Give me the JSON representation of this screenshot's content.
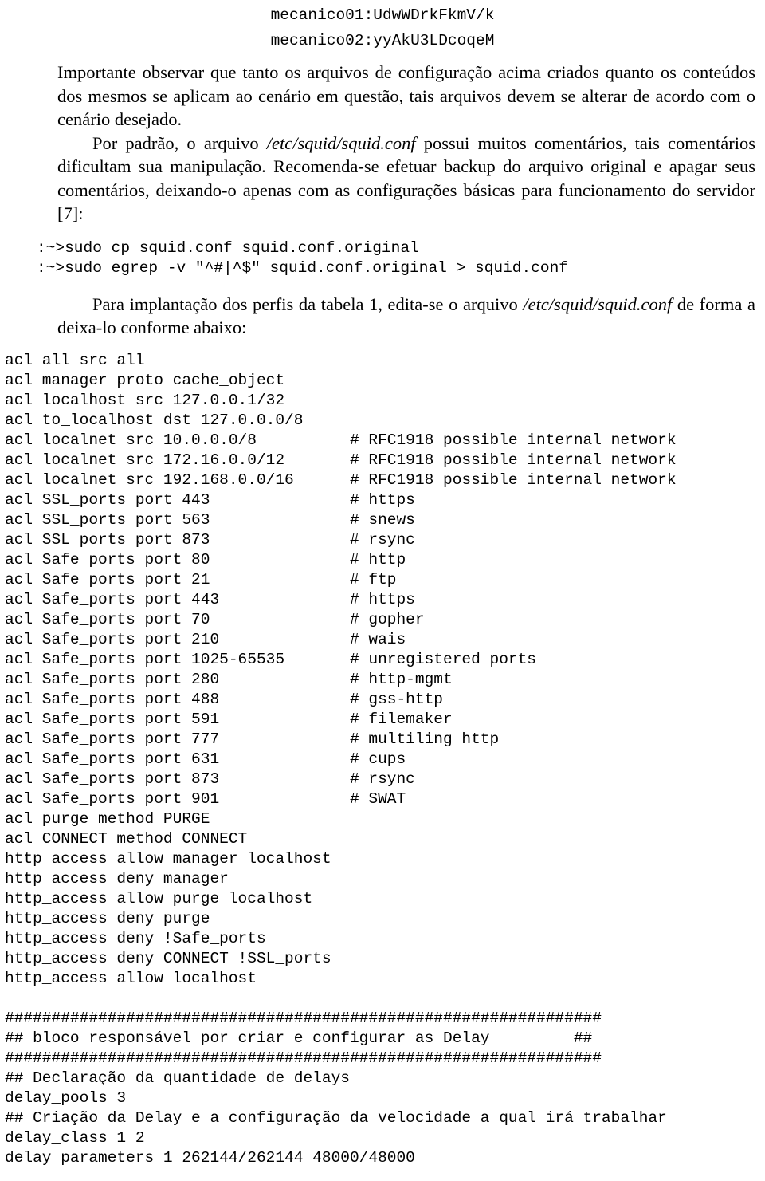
{
  "header": {
    "line1": "mecanico01:UdwWDrkFkmV/k",
    "line2": "mecanico02:yyAkU3LDcoqeM"
  },
  "paragraphs": {
    "p1": "Importante observar que tanto os arquivos de configuração acima criados quanto os conteúdos dos mesmos se aplicam ao cenário em questão, tais arquivos devem se alterar de acordo com o cenário desejado.",
    "p2_a": "Por padrão, o arquivo ",
    "p2_italic1": "/etc/squid/squid.conf",
    "p2_b": " possui muitos comentários, tais comentários dificultam sua manipulação. Recomenda-se efetuar backup do arquivo original e apagar seus comentários, deixando-o apenas com as configurações básicas para funcionamento do servidor [7]:",
    "p3_a": "Para implantação dos perfis da tabela 1, edita-se o arquivo ",
    "p3_italic1": "/etc/squid/squid.conf",
    "p3_b": " de forma a deixa-lo conforme abaixo:"
  },
  "commands": ":~>sudo cp squid.conf squid.conf.original\n:~>sudo egrep -v \"^#|^$\" squid.conf.original > squid.conf",
  "config": "acl all src all\nacl manager proto cache_object\nacl localhost src 127.0.0.1/32\nacl to_localhost dst 127.0.0.0/8\nacl localnet src 10.0.0.0/8          # RFC1918 possible internal network\nacl localnet src 172.16.0.0/12       # RFC1918 possible internal network\nacl localnet src 192.168.0.0/16      # RFC1918 possible internal network\nacl SSL_ports port 443               # https\nacl SSL_ports port 563               # snews\nacl SSL_ports port 873               # rsync\nacl Safe_ports port 80               # http\nacl Safe_ports port 21               # ftp\nacl Safe_ports port 443              # https\nacl Safe_ports port 70               # gopher\nacl Safe_ports port 210              # wais\nacl Safe_ports port 1025-65535       # unregistered ports\nacl Safe_ports port 280              # http-mgmt\nacl Safe_ports port 488              # gss-http\nacl Safe_ports port 591              # filemaker\nacl Safe_ports port 777              # multiling http\nacl Safe_ports port 631              # cups\nacl Safe_ports port 873              # rsync\nacl Safe_ports port 901              # SWAT\nacl purge method PURGE\nacl CONNECT method CONNECT\nhttp_access allow manager localhost\nhttp_access deny manager\nhttp_access allow purge localhost\nhttp_access deny purge\nhttp_access deny !Safe_ports\nhttp_access deny CONNECT !SSL_ports\nhttp_access allow localhost\n\n################################################################\n## bloco responsável por criar e configurar as Delay         ##\n################################################################\n## Declaração da quantidade de delays\ndelay_pools 3\n## Criação da Delay e a configuração da velocidade a qual irá trabalhar\ndelay_class 1 2\ndelay_parameters 1 262144/262144 48000/48000"
}
